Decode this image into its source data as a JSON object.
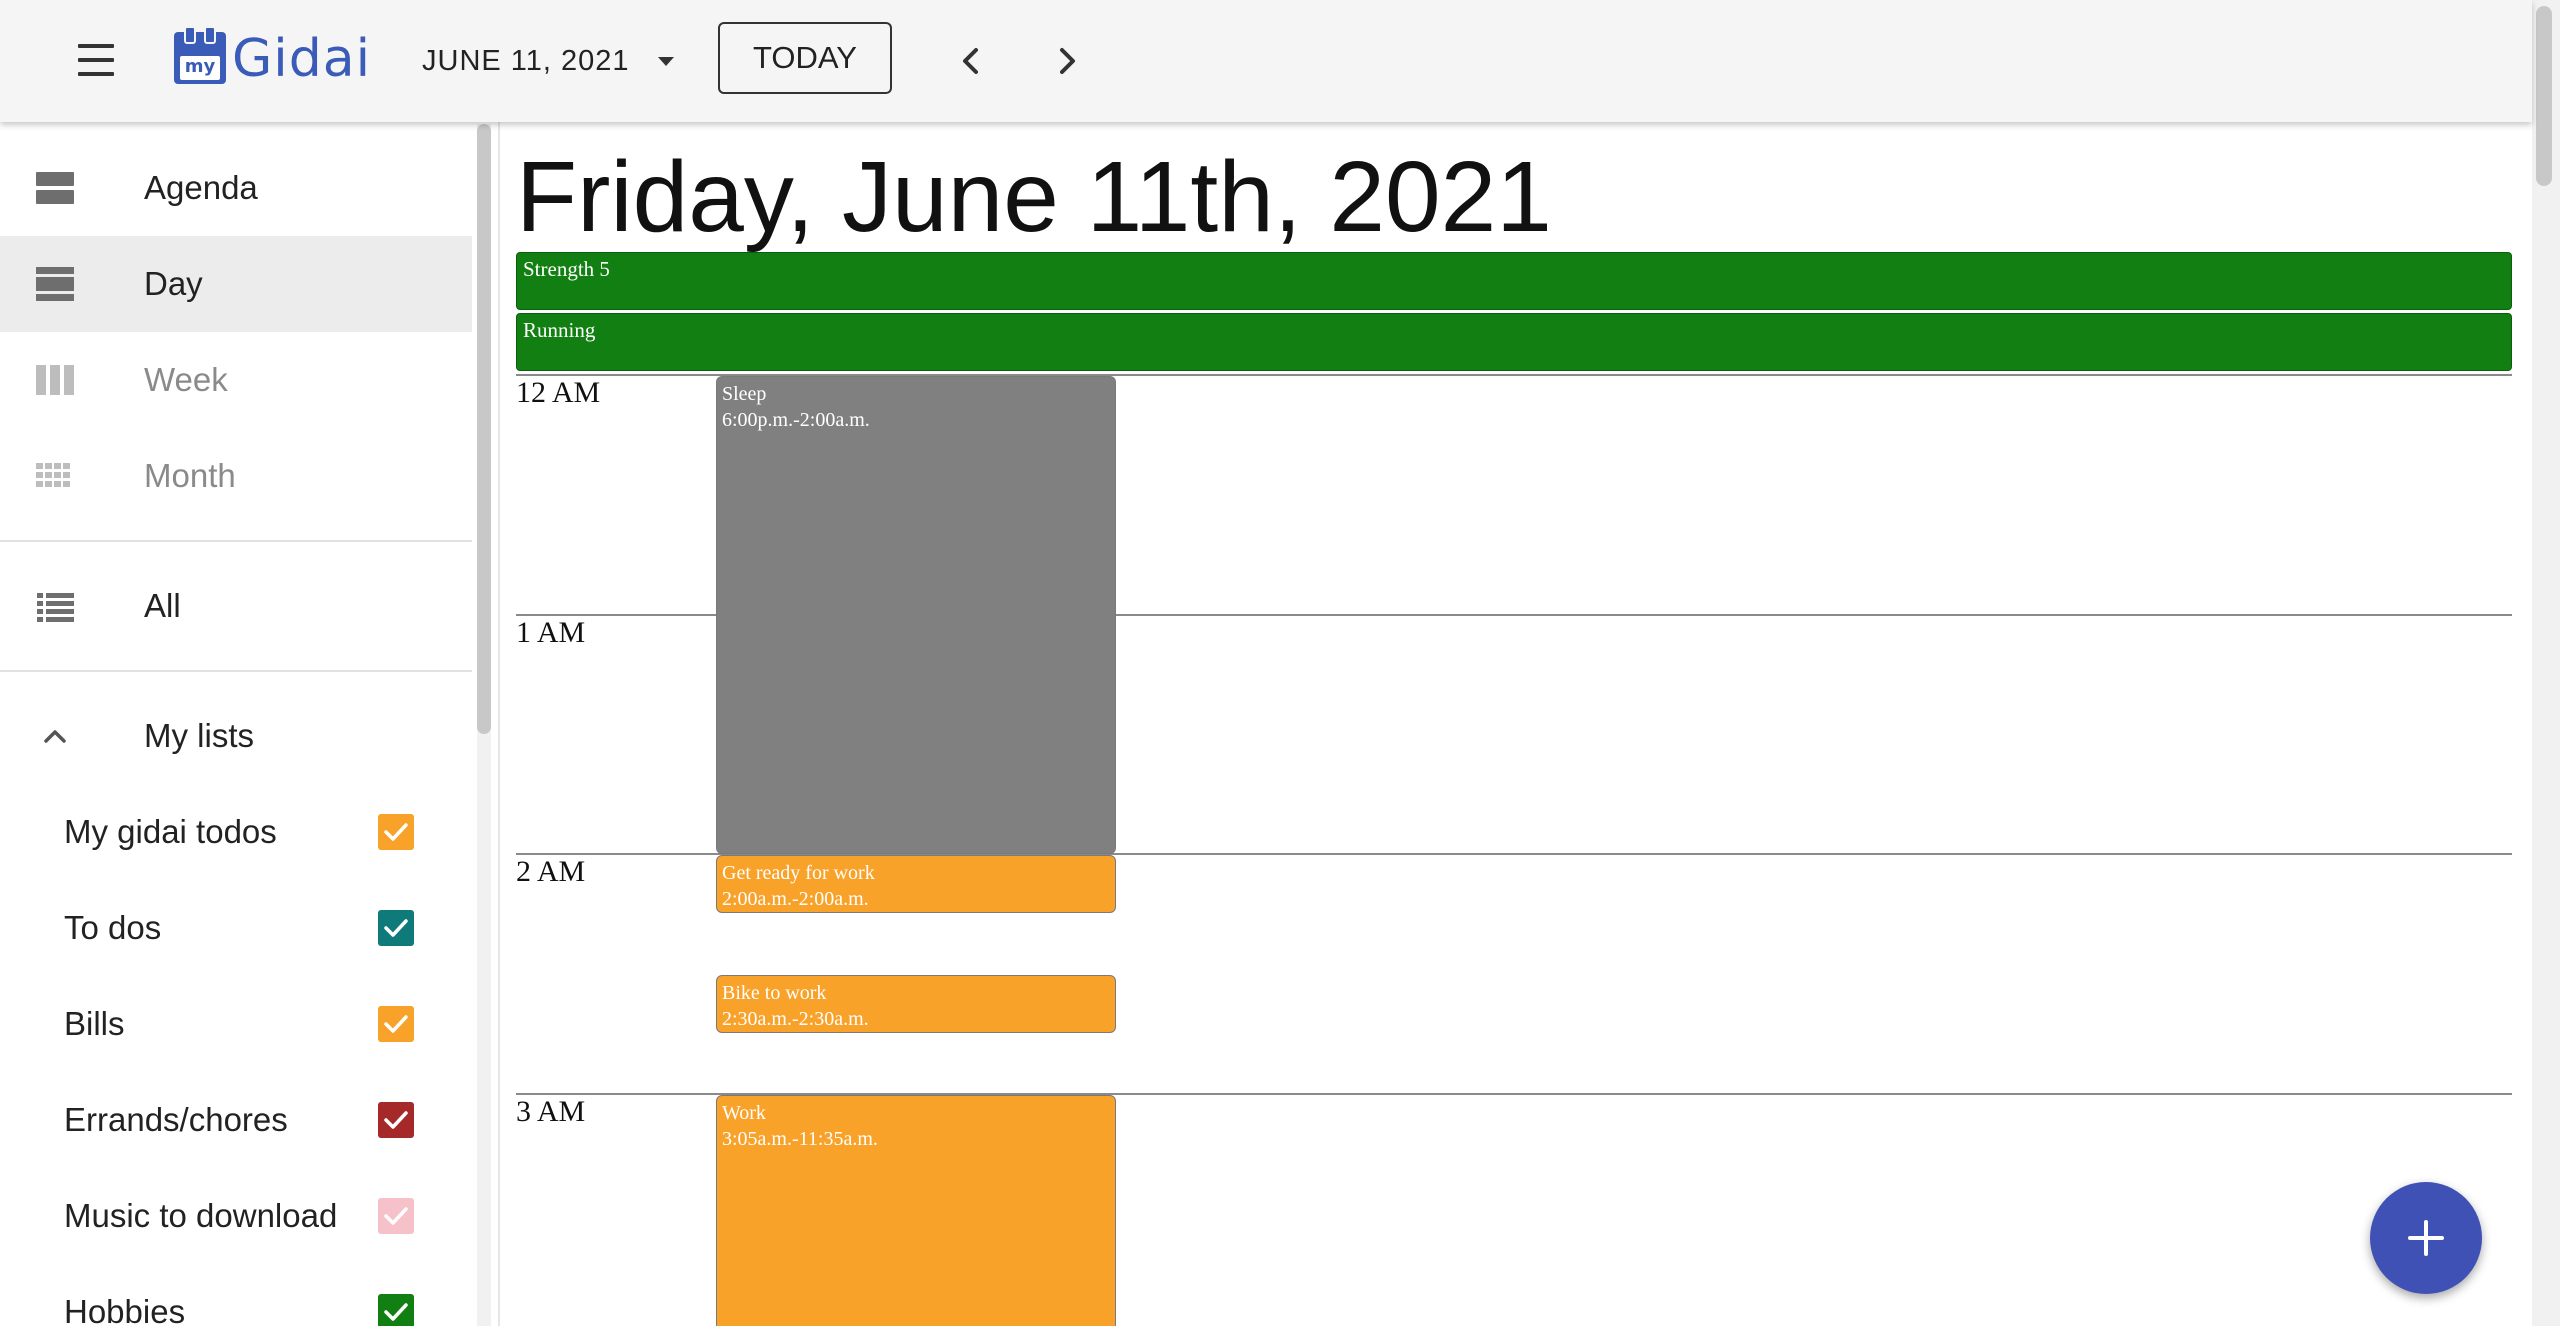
{
  "header": {
    "menu_icon": "hamburger-menu-icon",
    "logo": {
      "small_text": "my",
      "text": "Gidai"
    },
    "date_label": "JUNE 11, 2021",
    "today_label": "TODAY",
    "prev_icon": "chevron-left-icon",
    "next_icon": "chevron-right-icon"
  },
  "sidebar": {
    "views": [
      {
        "label": "Agenda",
        "icon": "agenda-view-icon"
      },
      {
        "label": "Day",
        "icon": "day-view-icon",
        "active": true
      },
      {
        "label": "Week",
        "icon": "week-view-icon"
      },
      {
        "label": "Month",
        "icon": "month-view-icon"
      }
    ],
    "all": {
      "label": "All",
      "icon": "list-icon"
    },
    "my_lists": {
      "label": "My lists",
      "icon": "chevron-up-icon",
      "items": [
        {
          "label": "My gidai todos",
          "color": "#f9a22a",
          "checked": true
        },
        {
          "label": "To dos",
          "color": "#0f7a7a",
          "checked": true
        },
        {
          "label": "Bills",
          "color": "#f9a22a",
          "checked": true
        },
        {
          "label": "Errands/chores",
          "color": "#a62929",
          "checked": true
        },
        {
          "label": "Music to download",
          "color": "#f6c1c8",
          "checked": true
        },
        {
          "label": "Hobbies",
          "color": "#117f11",
          "checked": true
        }
      ]
    }
  },
  "main": {
    "title": "Friday, June 11th, 2021",
    "all_day_events": [
      {
        "title": "Strength 5",
        "color": "#117f11"
      },
      {
        "title": "Running",
        "color": "#117f11"
      }
    ],
    "hours": [
      "12 AM",
      "1 AM",
      "2 AM",
      "3 AM"
    ],
    "events": [
      {
        "title": "Sleep",
        "time": "6:00p.m.-2:00a.m.",
        "color": "#808080"
      },
      {
        "title": "Get ready for work",
        "time": "2:00a.m.-2:00a.m.",
        "color": "#f9a22a"
      },
      {
        "title": "Bike to work",
        "time": "2:30a.m.-2:30a.m.",
        "color": "#f9a22a"
      },
      {
        "title": "Work",
        "time": "3:05a.m.-11:35a.m.",
        "color": "#f9a22a"
      }
    ]
  },
  "fab": {
    "icon": "plus-icon",
    "color": "#3f51b5"
  }
}
